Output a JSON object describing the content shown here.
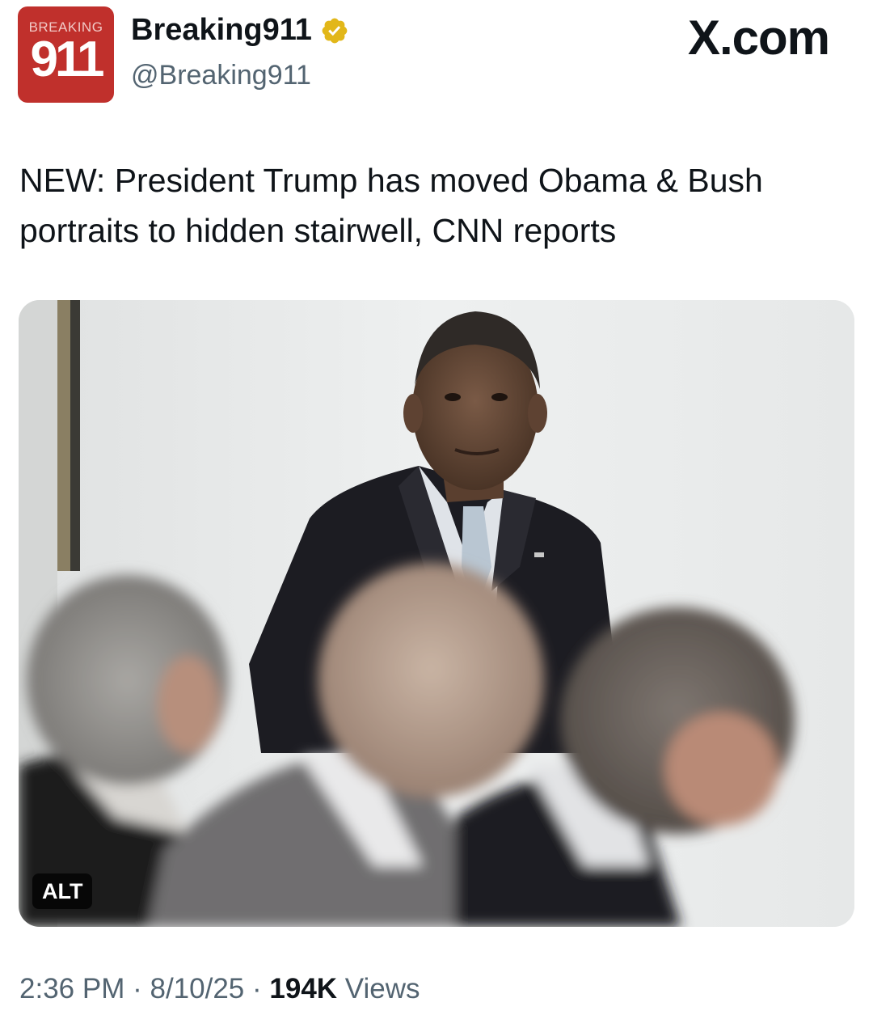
{
  "account": {
    "avatar_top_text": "BREAKING",
    "avatar_number": "911",
    "display_name": "Breaking911",
    "handle": "@Breaking911",
    "verified_color": "#e2b719",
    "avatar_color": "#c0302c"
  },
  "site_label": "X.com",
  "tweet": {
    "text": "NEW: President Trump has moved Obama & Bush portraits to hidden stairwell, CNN reports"
  },
  "media": {
    "alt_label": "ALT"
  },
  "meta": {
    "time": "2:36 PM",
    "separator1": "·",
    "date": "8/10/25",
    "separator2": "·",
    "views_count": "194K",
    "views_label": "Views"
  }
}
